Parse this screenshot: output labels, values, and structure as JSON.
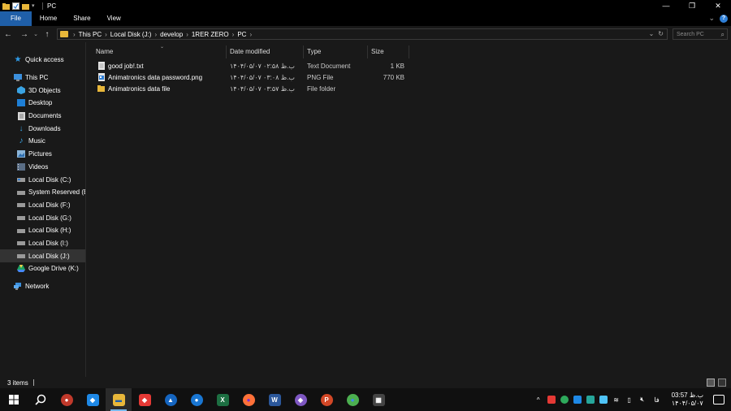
{
  "window": {
    "title": "PC",
    "controls": {
      "minimize": "—",
      "restore": "❐",
      "close": "✕"
    }
  },
  "ribbon": {
    "tabs": [
      {
        "label": "File",
        "active": true
      },
      {
        "label": "Home",
        "active": false
      },
      {
        "label": "Share",
        "active": false
      },
      {
        "label": "View",
        "active": false
      }
    ],
    "expand_glyph": "⌄",
    "help_label": "?"
  },
  "address": {
    "breadcrumbs": [
      "This PC",
      "Local Disk (J:)",
      "develop",
      "1RER ZERO",
      "PC"
    ],
    "search_placeholder": "Search PC"
  },
  "navigation": {
    "quick_access": "Quick access",
    "this_pc": "This PC",
    "items": [
      {
        "label": "3D Objects",
        "icon": "cube-icon",
        "selected": false
      },
      {
        "label": "Desktop",
        "icon": "desktop-icon",
        "selected": false
      },
      {
        "label": "Documents",
        "icon": "documents-icon",
        "selected": false
      },
      {
        "label": "Downloads",
        "icon": "download-icon",
        "selected": false
      },
      {
        "label": "Music",
        "icon": "music-icon",
        "selected": false
      },
      {
        "label": "Pictures",
        "icon": "pictures-icon",
        "selected": false
      },
      {
        "label": "Videos",
        "icon": "videos-icon",
        "selected": false
      },
      {
        "label": "Local Disk (C:)",
        "icon": "drive-icon",
        "selected": false
      },
      {
        "label": "System Reserved (E:)",
        "icon": "drive-icon",
        "selected": false
      },
      {
        "label": "Local Disk (F:)",
        "icon": "drive-icon",
        "selected": false
      },
      {
        "label": "Local Disk (G:)",
        "icon": "drive-icon",
        "selected": false
      },
      {
        "label": "Local Disk (H:)",
        "icon": "drive-icon",
        "selected": false
      },
      {
        "label": "Local Disk (I:)",
        "icon": "drive-icon",
        "selected": false
      },
      {
        "label": "Local Disk (J:)",
        "icon": "drive-icon",
        "selected": true
      },
      {
        "label": "Google Drive (K:)",
        "icon": "google-drive-icon",
        "selected": false
      }
    ],
    "network": "Network"
  },
  "files": {
    "columns": {
      "name": "Name",
      "date": "Date modified",
      "type": "Type",
      "size": "Size"
    },
    "rows": [
      {
        "name": "good job!.txt",
        "date": "۱۴۰۴/۰۵/۰۷ ب.ظ ۰۲:۵۸",
        "type": "Text Document",
        "size": "1 KB",
        "icon": "text-file-icon"
      },
      {
        "name": "Animatronics data password.png",
        "date": "۱۴۰۴/۰۵/۰۷ ب.ظ ۰۳:۰۸",
        "type": "PNG File",
        "size": "770 KB",
        "icon": "image-file-icon"
      },
      {
        "name": "Animatronics data file",
        "date": "۱۴۰۴/۰۵/۰۷ ب.ظ ۰۳:۵۷",
        "type": "File folder",
        "size": "",
        "icon": "folder-icon"
      }
    ]
  },
  "status": {
    "item_count": "3 items"
  },
  "taskbar": {
    "apps": [
      {
        "name": "app-1",
        "color": "#c0392b",
        "glyph": "●"
      },
      {
        "name": "app-2",
        "color": "#1e88e5",
        "glyph": "◆"
      },
      {
        "name": "file-explorer",
        "color": "#e8b73a",
        "glyph": "▬",
        "active": true
      },
      {
        "name": "anydesk",
        "color": "#e53935",
        "glyph": "◆"
      },
      {
        "name": "app-5",
        "color": "#1565c0",
        "glyph": "▲"
      },
      {
        "name": "app-6",
        "color": "#1976d2",
        "glyph": "●"
      },
      {
        "name": "excel",
        "color": "#1d6f42",
        "glyph": "X"
      },
      {
        "name": "firefox",
        "color": "#ff7139",
        "glyph": "●"
      },
      {
        "name": "word",
        "color": "#2b579a",
        "glyph": "W"
      },
      {
        "name": "app-10",
        "color": "#7e57c2",
        "glyph": "◈"
      },
      {
        "name": "powerpoint",
        "color": "#d24726",
        "glyph": "P"
      },
      {
        "name": "chrome",
        "color": "#4caf50",
        "glyph": "●"
      },
      {
        "name": "calculator",
        "color": "#444444",
        "glyph": "▦"
      }
    ],
    "language": "فا",
    "clock_time": "03:57 ب.ظ",
    "clock_date": "۱۴۰۴/۰۵/۰۷"
  },
  "colors": {
    "accent": "#1f5fa8",
    "folder": "#e8b73a",
    "background": "#191919"
  }
}
